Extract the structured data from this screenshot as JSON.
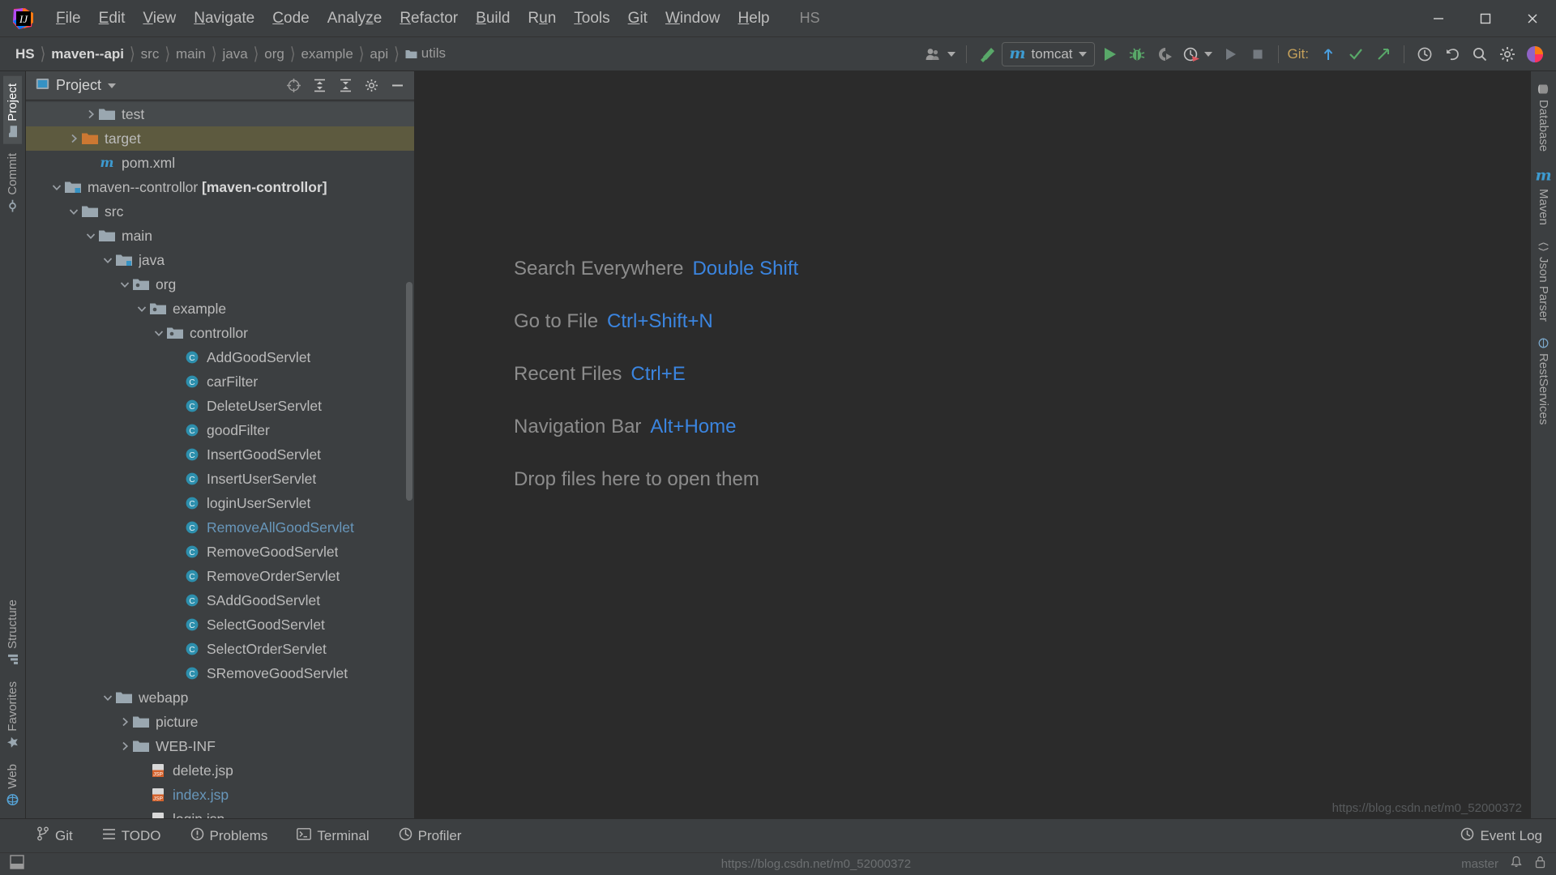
{
  "app": {
    "logo_name": "intellij-idea-logo",
    "project_short_name": "HS"
  },
  "menubar": {
    "items": [
      {
        "label": "File",
        "mnemonic": "F"
      },
      {
        "label": "Edit",
        "mnemonic": "E"
      },
      {
        "label": "View",
        "mnemonic": "V"
      },
      {
        "label": "Navigate",
        "mnemonic": "N"
      },
      {
        "label": "Code",
        "mnemonic": "C"
      },
      {
        "label": "Analyze",
        "mnemonic": "z"
      },
      {
        "label": "Refactor",
        "mnemonic": "R"
      },
      {
        "label": "Build",
        "mnemonic": "B"
      },
      {
        "label": "Run",
        "mnemonic": "u"
      },
      {
        "label": "Tools",
        "mnemonic": "T"
      },
      {
        "label": "Git",
        "mnemonic": "G"
      },
      {
        "label": "Window",
        "mnemonic": "W"
      },
      {
        "label": "Help",
        "mnemonic": "H"
      }
    ],
    "project_label": "HS",
    "window_controls": {
      "minimize": "Minimize",
      "maximize": "Maximize",
      "close": "Close"
    }
  },
  "navbar": {
    "breadcrumbs": [
      {
        "label": "HS",
        "style": "bold"
      },
      {
        "label": "maven--api",
        "style": "bold"
      },
      {
        "label": "src",
        "style": "dim"
      },
      {
        "label": "main",
        "style": "dim"
      },
      {
        "label": "java",
        "style": "dim"
      },
      {
        "label": "org",
        "style": "dim"
      },
      {
        "label": "example",
        "style": "dim"
      },
      {
        "label": "api",
        "style": "dim"
      },
      {
        "label": "utils",
        "style": "dim"
      }
    ],
    "separator": "〉",
    "toolbar": {
      "user_icon": "user-accounts-icon",
      "user_caret": "chevron-down-icon",
      "build_icon": "build-hammer-icon",
      "run_config": {
        "prefix_glyph": "m",
        "label": "tomcat",
        "caret": "chevron-down-icon"
      },
      "run_icon": "run-play-icon",
      "debug_icon": "debug-bug-icon",
      "run_coverage_icon": "run-with-coverage-icon",
      "profiler_icon": "profiler-clock-icon",
      "profiler_caret": "chevron-down-icon",
      "rerun_icon": "rerun-play-icon",
      "stop_icon": "stop-square-icon",
      "git_label": "Git:",
      "git_update_icon": "git-update-project-icon",
      "git_commit_icon": "git-commit-check-icon",
      "git_push_icon": "git-push-arrow-icon",
      "history_icon": "history-clock-icon",
      "undo_icon": "undo-arrow-icon",
      "search_icon": "search-icon",
      "settings_icon": "gear-icon",
      "ide_avatar_icon": "ide-avatar-icon"
    }
  },
  "left_stripe": {
    "top_items": [
      {
        "label": "Project",
        "icon": "project-folder-icon",
        "active": true
      },
      {
        "label": "Commit",
        "icon": "commit-icon",
        "active": false
      }
    ],
    "bottom_items": [
      {
        "label": "Structure",
        "icon": "structure-icon",
        "active": false
      },
      {
        "label": "Favorites",
        "icon": "favorites-star-icon",
        "active": false
      },
      {
        "label": "Web",
        "icon": "web-globe-icon",
        "active": false
      }
    ]
  },
  "right_stripe": {
    "items": [
      {
        "label": "Database",
        "icon": "database-icon"
      },
      {
        "label": "Maven",
        "icon": "maven-m-icon"
      },
      {
        "label": "Json Parser",
        "icon": "json-parser-icon"
      },
      {
        "label": "RestServices",
        "icon": "rest-services-icon"
      }
    ]
  },
  "project_panel": {
    "title": "Project",
    "title_caret": "chevron-down-icon",
    "actions": [
      {
        "name": "scroll-from-source-icon",
        "tooltip": "Select Opened File"
      },
      {
        "name": "expand-all-icon",
        "tooltip": "Expand All"
      },
      {
        "name": "collapse-all-icon",
        "tooltip": "Collapse All"
      },
      {
        "name": "gear-icon",
        "tooltip": "Options"
      },
      {
        "name": "hide-icon",
        "tooltip": "Hide"
      }
    ],
    "tree": [
      {
        "label": "test",
        "icon": "folder-icon",
        "indent": 3,
        "arrow": "right",
        "state": "normal"
      },
      {
        "label": "target",
        "icon": "folder-orange-icon",
        "indent": 2,
        "arrow": "right",
        "state": "selected-inactive"
      },
      {
        "label": "pom.xml",
        "icon": "maven-m-icon",
        "indent": 3,
        "arrow": "none",
        "state": "normal"
      },
      {
        "label": "maven--controllor ",
        "suffix": "[maven-controllor]",
        "icon": "module-folder-icon",
        "indent": 1,
        "arrow": "down",
        "state": "normal"
      },
      {
        "label": "src",
        "icon": "folder-icon",
        "indent": 2,
        "arrow": "down",
        "state": "normal"
      },
      {
        "label": "main",
        "icon": "folder-icon",
        "indent": 3,
        "arrow": "down",
        "state": "normal"
      },
      {
        "label": "java",
        "icon": "folder-blue-icon",
        "indent": 4,
        "arrow": "down",
        "state": "normal"
      },
      {
        "label": "org",
        "icon": "package-icon",
        "indent": 5,
        "arrow": "down",
        "state": "normal"
      },
      {
        "label": "example",
        "icon": "package-icon",
        "indent": 6,
        "arrow": "down",
        "state": "normal"
      },
      {
        "label": "controllor",
        "icon": "package-icon",
        "indent": 7,
        "arrow": "down",
        "state": "normal"
      },
      {
        "label": "AddGoodServlet",
        "icon": "java-class-icon",
        "indent": 8,
        "arrow": "none",
        "state": "normal"
      },
      {
        "label": "carFilter",
        "icon": "java-class-icon",
        "indent": 8,
        "arrow": "none",
        "state": "normal"
      },
      {
        "label": "DeleteUserServlet",
        "icon": "java-class-icon",
        "indent": 8,
        "arrow": "none",
        "state": "normal"
      },
      {
        "label": "goodFilter",
        "icon": "java-class-icon",
        "indent": 8,
        "arrow": "none",
        "state": "normal"
      },
      {
        "label": "InsertGoodServlet",
        "icon": "java-class-icon",
        "indent": 8,
        "arrow": "none",
        "state": "normal"
      },
      {
        "label": "InsertUserServlet",
        "icon": "java-class-icon",
        "indent": 8,
        "arrow": "none",
        "state": "normal"
      },
      {
        "label": "loginUserServlet",
        "icon": "java-class-icon",
        "indent": 8,
        "arrow": "none",
        "state": "normal"
      },
      {
        "label": "RemoveAllGoodServlet",
        "icon": "java-class-icon",
        "indent": 8,
        "arrow": "none",
        "state": "modified"
      },
      {
        "label": "RemoveGoodServlet",
        "icon": "java-class-icon",
        "indent": 8,
        "arrow": "none",
        "state": "normal"
      },
      {
        "label": "RemoveOrderServlet",
        "icon": "java-class-icon",
        "indent": 8,
        "arrow": "none",
        "state": "normal"
      },
      {
        "label": "SAddGoodServlet",
        "icon": "java-class-icon",
        "indent": 8,
        "arrow": "none",
        "state": "normal"
      },
      {
        "label": "SelectGoodServlet",
        "icon": "java-class-icon",
        "indent": 8,
        "arrow": "none",
        "state": "normal"
      },
      {
        "label": "SelectOrderServlet",
        "icon": "java-class-icon",
        "indent": 8,
        "arrow": "none",
        "state": "normal"
      },
      {
        "label": "SRemoveGoodServlet",
        "icon": "java-class-icon",
        "indent": 8,
        "arrow": "none",
        "state": "normal"
      },
      {
        "label": "webapp",
        "icon": "folder-icon",
        "indent": 4,
        "arrow": "down",
        "state": "normal"
      },
      {
        "label": "picture",
        "icon": "folder-icon",
        "indent": 5,
        "arrow": "right",
        "state": "normal"
      },
      {
        "label": "WEB-INF",
        "icon": "folder-icon",
        "indent": 5,
        "arrow": "right",
        "state": "normal"
      },
      {
        "label": "delete.jsp",
        "icon": "jsp-file-icon",
        "indent": 6,
        "arrow": "none",
        "state": "normal"
      },
      {
        "label": "index.jsp",
        "icon": "jsp-file-icon",
        "indent": 6,
        "arrow": "none",
        "state": "modified"
      },
      {
        "label": "login.jsp",
        "icon": "jsp-file-icon",
        "indent": 6,
        "arrow": "none",
        "state": "normal"
      }
    ]
  },
  "editor": {
    "hints": [
      {
        "action": "Search Everywhere",
        "shortcut": "Double Shift"
      },
      {
        "action": "Go to File",
        "shortcut": "Ctrl+Shift+N"
      },
      {
        "action": "Recent Files",
        "shortcut": "Ctrl+E"
      },
      {
        "action": "Navigation Bar",
        "shortcut": "Alt+Home"
      },
      {
        "action": "Drop files here to open them",
        "shortcut": ""
      }
    ]
  },
  "statusbar": {
    "items": [
      {
        "label": "Git",
        "icon": "git-branch-icon"
      },
      {
        "label": "TODO",
        "icon": "todo-list-icon"
      },
      {
        "label": "Problems",
        "icon": "problems-warning-icon"
      },
      {
        "label": "Terminal",
        "icon": "terminal-icon"
      },
      {
        "label": "Profiler",
        "icon": "profiler-icon"
      }
    ],
    "event_log": {
      "label": "Event Log",
      "icon": "event-log-icon"
    }
  },
  "bottombar": {
    "layout_icon": "layout-toggle-icon",
    "watermark_url": "https://blog.csdn.net/m0_52000372",
    "master_label": "master",
    "notification_icon": "notification-bell-icon",
    "lock_icon": "lock-icon"
  },
  "colors": {
    "bg_main": "#3c3f41",
    "bg_editor": "#2b2b2b",
    "accent_blue": "#3b85e0",
    "text": "#bbbbbb",
    "selection_inactive": "#5d5a3f",
    "maven_blue": "#3d9bd1",
    "orange_folder": "#cc7832",
    "git_label": "#c7a25b"
  }
}
